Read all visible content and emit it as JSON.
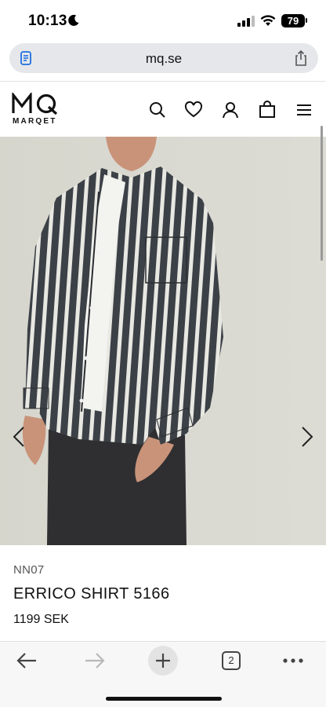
{
  "status_bar": {
    "time": "10:13",
    "battery": "79"
  },
  "browser": {
    "url": "mq.se",
    "tabs_count": "2"
  },
  "site": {
    "logo_text": "MARQET"
  },
  "product": {
    "brand": "NN07",
    "title": "ERRICO SHIRT 5166",
    "price": "1199 SEK"
  },
  "icons": {
    "moon": "moon-icon",
    "signal": "cellular-signal-icon",
    "wifi": "wifi-icon",
    "battery": "battery-icon",
    "page": "page-icon",
    "share": "share-icon",
    "search": "search-icon",
    "heart": "heart-icon",
    "account": "user-icon",
    "bag": "shopping-bag-icon",
    "menu": "menu-icon",
    "prev": "chevron-left-icon",
    "next": "chevron-right-icon",
    "back": "arrow-left-icon",
    "forward": "arrow-right-icon",
    "new_tab": "plus-icon",
    "more": "more-icon"
  },
  "colors": {
    "background": "#ffffff",
    "photo_backdrop": "#d9d9d1",
    "shirt_stripe_dark": "#3c4147",
    "text": "#111111"
  }
}
